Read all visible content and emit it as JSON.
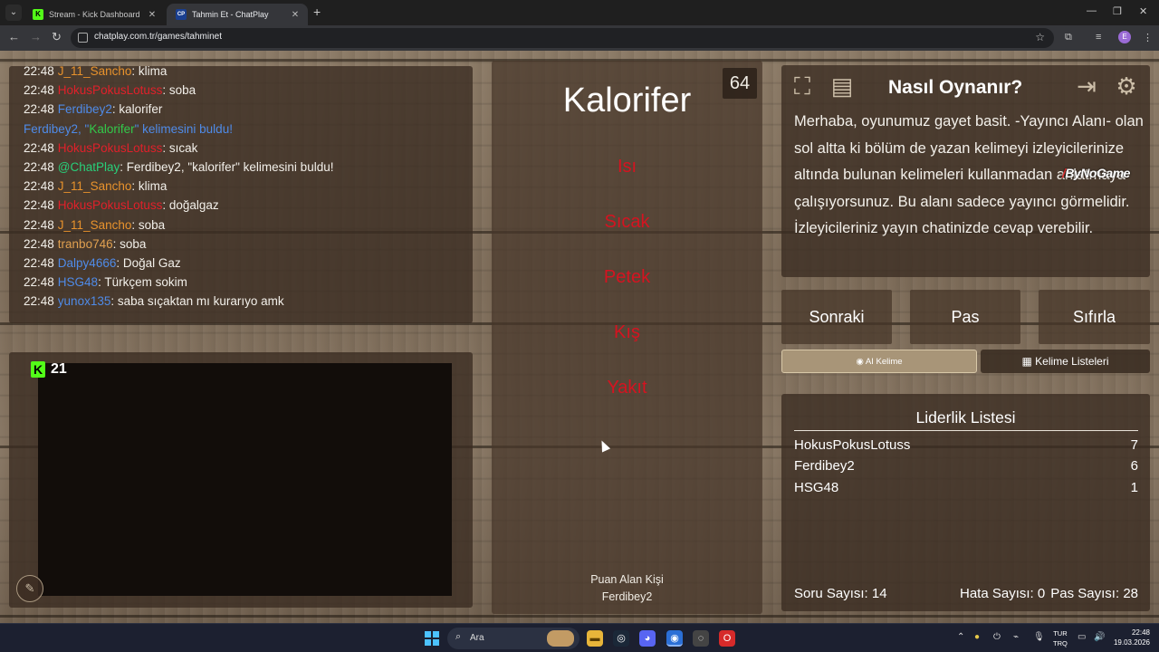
{
  "browser": {
    "tabs": [
      {
        "title": "Stream - Kick Dashboard",
        "favicon": "K",
        "active": false
      },
      {
        "title": "Tahmin Et - ChatPlay",
        "favicon": "CP",
        "active": true
      }
    ],
    "url": "chatplay.com.tr/games/tahminet",
    "profile_initial": "E"
  },
  "chat": {
    "lines": [
      {
        "time": "22:48",
        "user": "J_11_Sancho",
        "user_color": "orange",
        "msg": "klima"
      },
      {
        "time": "22:48",
        "user": "HokusPokusLotuss",
        "user_color": "red",
        "msg": "soba"
      },
      {
        "time": "22:48",
        "user": "Ferdibey2",
        "user_color": "blue",
        "msg": "kalorifer"
      },
      {
        "time": "",
        "user": "",
        "user_color": "sys",
        "msg": "",
        "system": {
          "pre": "Ferdibey2, \"",
          "word": "Kalorifer",
          "post": "\" kelimesini buldu!"
        }
      },
      {
        "time": "22:48",
        "user": "HokusPokusLotuss",
        "user_color": "red",
        "msg": "sıcak"
      },
      {
        "time": "22:48",
        "user": "@ChatPlay",
        "user_color": "green",
        "msg": "Ferdibey2, \"kalorifer\" kelimesini buldu!"
      },
      {
        "time": "22:48",
        "user": "J_11_Sancho",
        "user_color": "orange",
        "msg": "klima"
      },
      {
        "time": "22:48",
        "user": "HokusPokusLotuss",
        "user_color": "red",
        "msg": "doğalgaz"
      },
      {
        "time": "22:48",
        "user": "J_11_Sancho",
        "user_color": "orange",
        "msg": "soba"
      },
      {
        "time": "22:48",
        "user": "tranbo746",
        "user_color": "tan",
        "msg": "soba"
      },
      {
        "time": "22:48",
        "user": "Dalpy4666",
        "user_color": "blue",
        "msg": "Doğal Gaz"
      },
      {
        "time": "22:48",
        "user": "HSG48",
        "user_color": "blue",
        "msg": "Türkçem sokim"
      },
      {
        "time": "22:48",
        "user": "yunox135",
        "user_color": "blue",
        "msg": "saba sıçaktan mı kurarıyo amk"
      }
    ]
  },
  "stream": {
    "viewer_count": "21",
    "platform": "K"
  },
  "game": {
    "timer": "64",
    "word": "Kalorifer",
    "taboo_words": [
      "Isı",
      "Sıcak",
      "Petek",
      "Kış",
      "Yakıt"
    ],
    "scorer_label": "Puan Alan Kişi",
    "scorer": "Ferdibey2"
  },
  "help": {
    "title": "Nasıl Oynanır?",
    "text": "Merhaba, oyunumuz gayet basit. -Yayıncı Alanı- olan sol altta ki bölüm de yazan kelimeyi izleyicilerinize altında bulunan kelimeleri kullanmadan anlatmaya çalışıyorsunuz. Bu alanı sadece yayıncı görmelidir. İzleyicileriniz yayın chatinizde cevap verebilir.",
    "brand": "ByNoGame"
  },
  "controls": {
    "next": "Sonraki",
    "pass": "Pas",
    "reset": "Sıfırla",
    "ai_word": "AI Kelime",
    "word_lists": "Kelime Listeleri"
  },
  "leaderboard": {
    "title": "Liderlik Listesi",
    "rows": [
      {
        "name": "HokusPokusLotuss",
        "score": "7"
      },
      {
        "name": "Ferdibey2",
        "score": "6"
      },
      {
        "name": "HSG48",
        "score": "1"
      }
    ],
    "questions_label": "Soru Sayısı: 14",
    "errors_label": "Hata Sayısı: 0",
    "passes_label": "Pas Sayısı: 28"
  },
  "taskbar": {
    "search_placeholder": "Ara",
    "lang_top": "TUR",
    "lang_bottom": "TRQ",
    "time": "22:48",
    "date": "19.03.2026"
  },
  "colors": {
    "taboo_red": "#d51320",
    "kick_green": "#53fc18"
  }
}
